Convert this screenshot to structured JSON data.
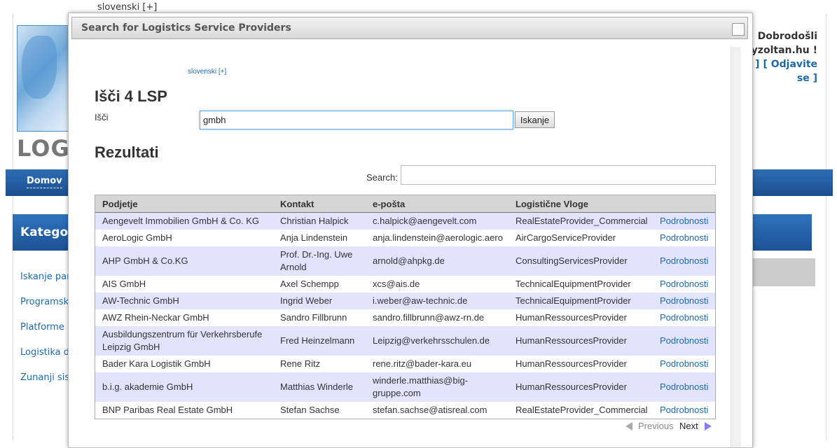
{
  "background": {
    "language": "slovenski [+]",
    "logo_text": "LOG",
    "nav_home": "Domov",
    "categories_label": "Kategorij",
    "sidebar_links": [
      "Iskanje part",
      "Programska",
      "Platforme",
      "Logistika do",
      "Zunanji sist"
    ],
    "welcome": "Dobrodošli",
    "user": "@bayzoltan.hu !",
    "account_prefix": "geslo ] [",
    "logout_1": "Odjavite",
    "logout_2": "se ]"
  },
  "dialog": {
    "title": "Search for Logistics Service Providers",
    "language": "slovenski [+]",
    "heading": "Išči 4 LSP",
    "search_label": "Išči",
    "search_value": "gmbh",
    "search_button": "Iskanje",
    "results_heading": "Rezultati",
    "filter_label": "Search:",
    "filter_value": "",
    "columns": [
      "Podjetje",
      "Kontakt",
      "e-pošta",
      "Logistične Vloge",
      ""
    ],
    "rows": [
      {
        "company": "Aengevelt Immobilien GmbH & Co. KG",
        "contact": "Christian Halpick",
        "email": "c.halpick@aengevelt.com",
        "role": "RealEstateProvider_Commercial",
        "link": "Podrobnosti"
      },
      {
        "company": "AeroLogic GmbH",
        "contact": "Anja Lindenstein",
        "email": "anja.lindenstein@aerologic.aero",
        "role": "AirCargoServiceProvider",
        "link": "Podrobnosti"
      },
      {
        "company": "AHP GmbH & Co.KG",
        "contact": "Prof. Dr.-Ing. Uwe Arnold",
        "email": "arnold@ahpkg.de",
        "role": "ConsultingServicesProvider",
        "link": "Podrobnosti"
      },
      {
        "company": "AIS GmbH",
        "contact": "Axel Schempp",
        "email": "xcs@ais.de",
        "role": "TechnicalEquipmentProvider",
        "link": "Podrobnosti"
      },
      {
        "company": "AW-Technic GmbH",
        "contact": "Ingrid Weber",
        "email": "i.weber@aw-technic.de",
        "role": "TechnicalEquipmentProvider",
        "link": "Podrobnosti"
      },
      {
        "company": "AWZ Rhein-Neckar GmbH",
        "contact": "Sandro Fillbrunn",
        "email": "sandro.fillbrunn@awz-rn.de",
        "role": "HumanRessourcesProvider",
        "link": "Podrobnosti"
      },
      {
        "company": "Ausbildungszentrum für Verkehrsberufe Leipzig GmbH",
        "contact": "Fred Heinzelmann",
        "email": "Leipzig@verkehrsschulen.de",
        "role": "HumanRessourcesProvider",
        "link": "Podrobnosti"
      },
      {
        "company": "Bader Kara Logistik GmbH",
        "contact": "Rene Ritz",
        "email": "rene.ritz@bader-kara.eu",
        "role": "HumanRessourcesProvider",
        "link": "Podrobnosti"
      },
      {
        "company": "b.i.g. akademie GmbH",
        "contact": "Matthias Winderle",
        "email": "winderle.matthias@big-gruppe.com",
        "role": "HumanRessourcesProvider",
        "link": "Podrobnosti"
      },
      {
        "company": "BNP Paribas Real Estate GmbH",
        "contact": "Stefan Sachse",
        "email": "stefan.sachse@atisreal.com",
        "role": "RealEstateProvider_Commercial",
        "link": "Podrobnosti"
      }
    ],
    "pager": {
      "previous": "Previous",
      "next": "Next"
    }
  }
}
